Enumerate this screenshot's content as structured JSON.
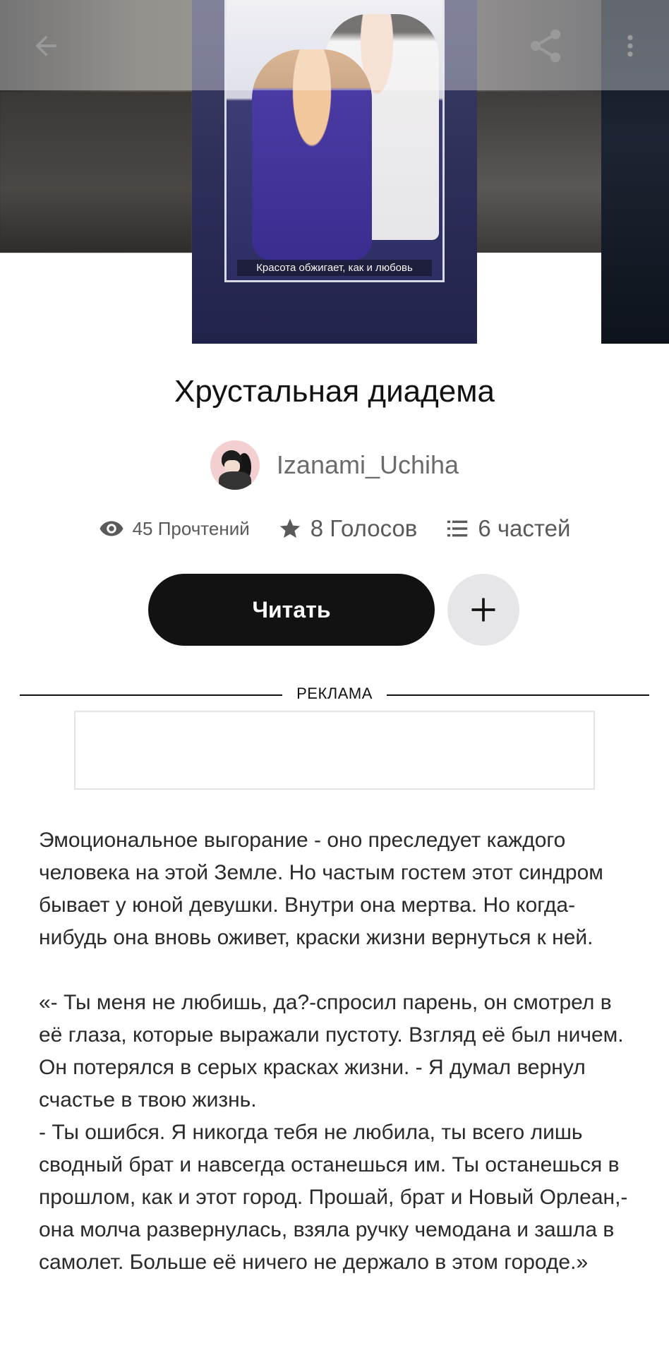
{
  "topbar": {
    "back_icon": "arrow-left-icon",
    "share_icon": "share-icon",
    "more_icon": "more-vertical-icon"
  },
  "cover": {
    "caption": "Красота обжигает, как и любовь"
  },
  "book": {
    "title": "Хрустальная диадема",
    "author": "Izanami_Uchiha"
  },
  "stats": {
    "reads": "45 Прочтений",
    "votes": "8 Голосов",
    "parts": "6 частей"
  },
  "actions": {
    "read_label": "Читать",
    "add_icon": "plus-icon"
  },
  "ad": {
    "label": "РЕКЛАМА"
  },
  "description": {
    "paragraph1": "Эмоциональное выгорание - оно преследует каждого человека на этой Земле. Но частым гостем этот синдром бывает у юной девушки. Внутри она мертва. Но когда-нибудь она вновь оживет, краски жизни вернуться к ней.",
    "paragraph2": "«- Ты меня не любишь, да?-спросил парень, он смотрел в её глаза, которые выражали пустоту. Взгляд её был ничем. Он потерялся в серых красках жизни. - Я думал вернул счастье в твою жизнь.\n- Ты ошибся. Я никогда тебя не любила, ты всего лишь сводный брат и навсегда останешься им. Ты останешься в прошлом, как и этот город. Прошай, брат и Новый Орлеан,- она молча развернулась, взяла ручку чемодана и зашла в самолет. Больше её ничего не держало в этом городе.»"
  }
}
